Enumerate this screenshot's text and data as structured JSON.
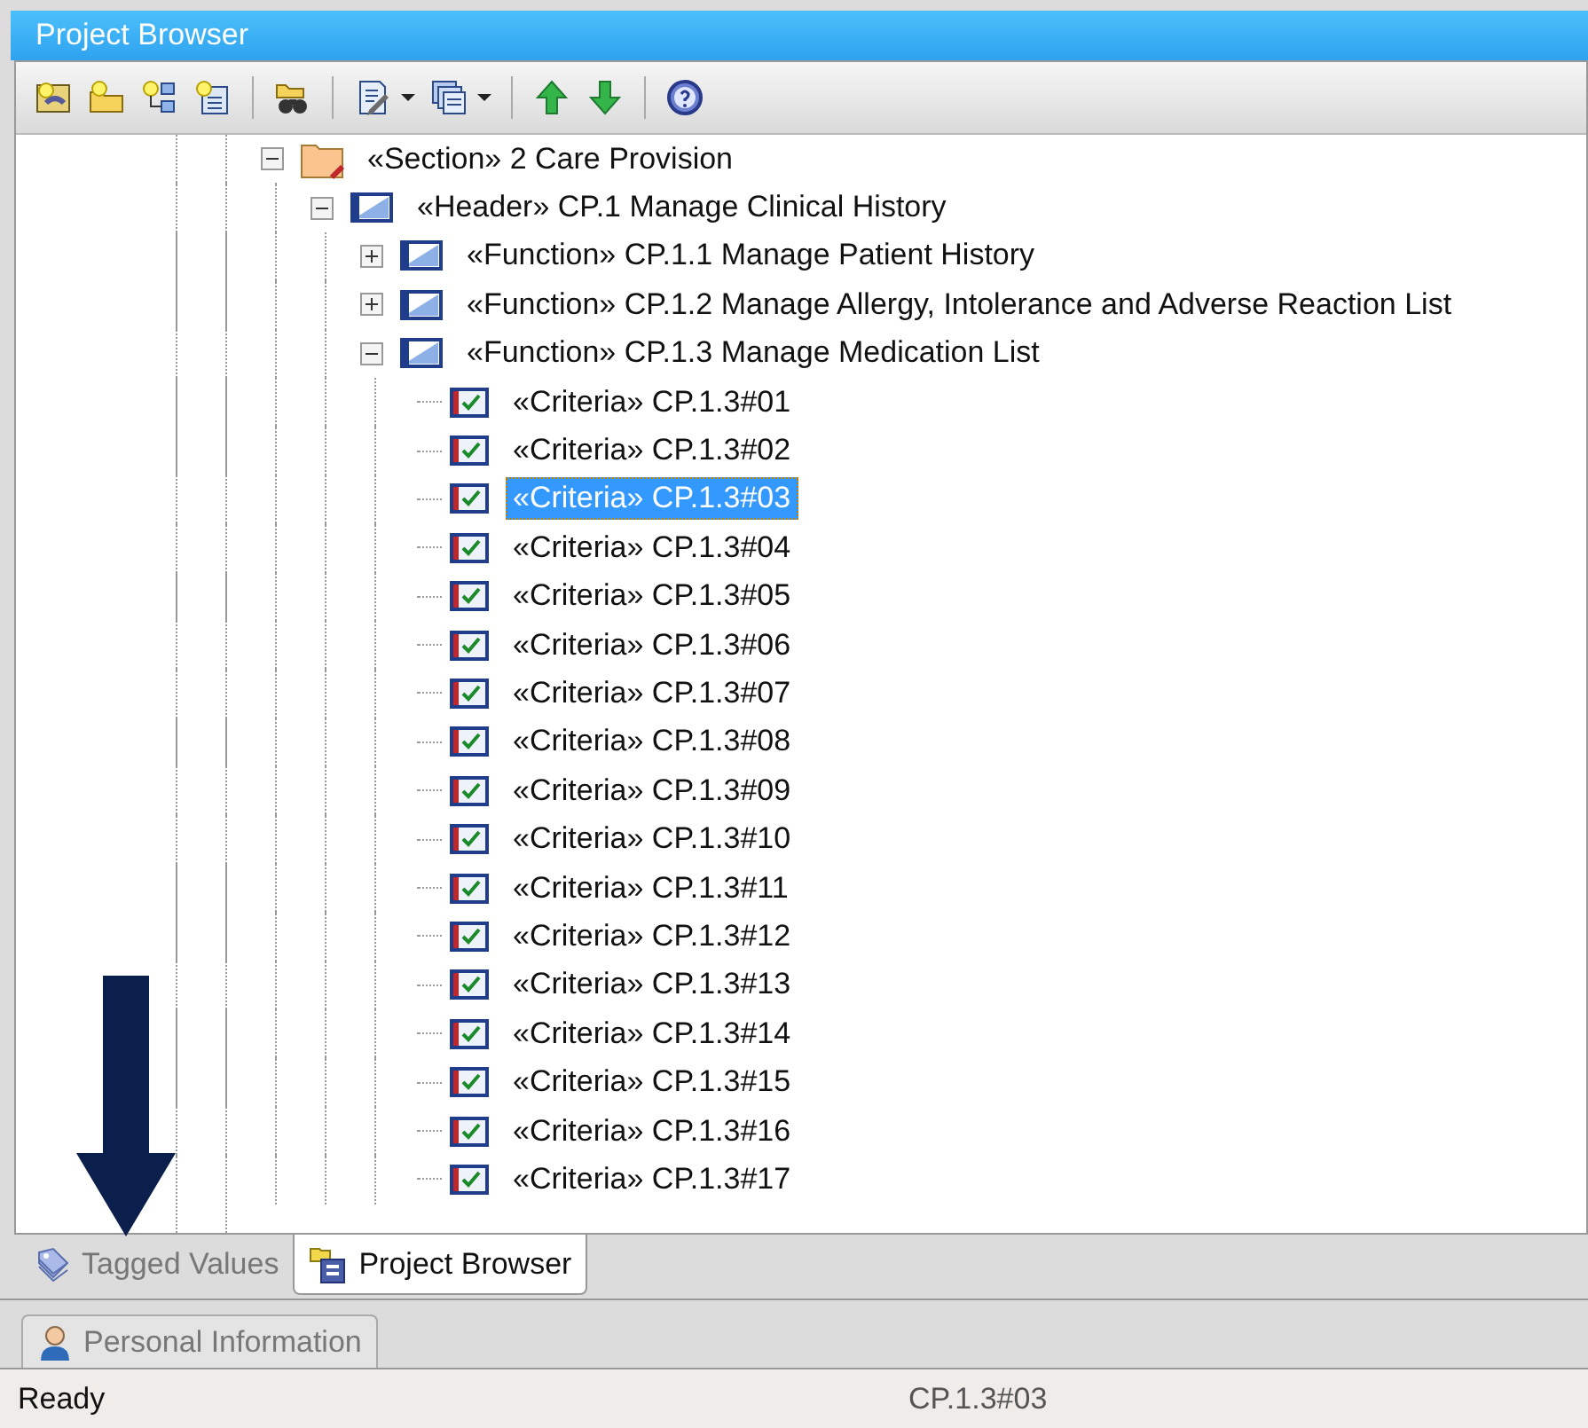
{
  "window": {
    "title": "Project Browser"
  },
  "tree": [
    {
      "kind": "folder",
      "label": "«Section» 2 Care Provision",
      "expanded": true,
      "selected": false,
      "children": [
        {
          "kind": "element",
          "label": "«Header» CP.1 Manage Clinical History",
          "expanded": true,
          "selected": false,
          "children": [
            {
              "kind": "element",
              "label": "«Function» CP.1.1 Manage Patient History",
              "expanded": false,
              "selected": false
            },
            {
              "kind": "element",
              "label": "«Function» CP.1.2 Manage Allergy, Intolerance and Adverse Reaction List",
              "expanded": false,
              "selected": false
            },
            {
              "kind": "element",
              "label": "«Function» CP.1.3 Manage Medication List",
              "expanded": true,
              "selected": false,
              "children": [
                {
                  "kind": "criteria",
                  "label": "«Criteria» CP.1.3#01",
                  "selected": false
                },
                {
                  "kind": "criteria",
                  "label": "«Criteria» CP.1.3#02",
                  "selected": false
                },
                {
                  "kind": "criteria",
                  "label": "«Criteria» CP.1.3#03",
                  "selected": true
                },
                {
                  "kind": "criteria",
                  "label": "«Criteria» CP.1.3#04",
                  "selected": false
                },
                {
                  "kind": "criteria",
                  "label": "«Criteria» CP.1.3#05",
                  "selected": false
                },
                {
                  "kind": "criteria",
                  "label": "«Criteria» CP.1.3#06",
                  "selected": false
                },
                {
                  "kind": "criteria",
                  "label": "«Criteria» CP.1.3#07",
                  "selected": false
                },
                {
                  "kind": "criteria",
                  "label": "«Criteria» CP.1.3#08",
                  "selected": false
                },
                {
                  "kind": "criteria",
                  "label": "«Criteria» CP.1.3#09",
                  "selected": false
                },
                {
                  "kind": "criteria",
                  "label": "«Criteria» CP.1.3#10",
                  "selected": false
                },
                {
                  "kind": "criteria",
                  "label": "«Criteria» CP.1.3#11",
                  "selected": false
                },
                {
                  "kind": "criteria",
                  "label": "«Criteria» CP.1.3#12",
                  "selected": false
                },
                {
                  "kind": "criteria",
                  "label": "«Criteria» CP.1.3#13",
                  "selected": false
                },
                {
                  "kind": "criteria",
                  "label": "«Criteria» CP.1.3#14",
                  "selected": false
                },
                {
                  "kind": "criteria",
                  "label": "«Criteria» CP.1.3#15",
                  "selected": false
                },
                {
                  "kind": "criteria",
                  "label": "«Criteria» CP.1.3#16",
                  "selected": false
                },
                {
                  "kind": "criteria",
                  "label": "«Criteria» CP.1.3#17",
                  "selected": false
                }
              ]
            }
          ]
        }
      ]
    }
  ],
  "tabs": [
    {
      "label": "Tagged Values",
      "selected": false
    },
    {
      "label": "Project Browser",
      "selected": true
    }
  ],
  "tabs_row_2": [
    {
      "label": "Personal Information",
      "selected": false
    }
  ],
  "status_bar": {
    "message": "Ready",
    "selection": "CP.1.3#03"
  }
}
